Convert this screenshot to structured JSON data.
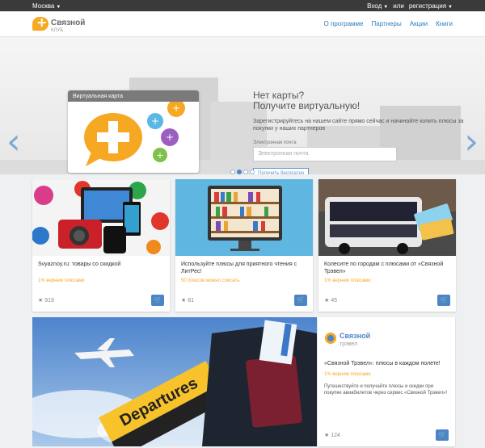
{
  "topbar": {
    "city": "Москва",
    "login": "Вход",
    "or": "или",
    "register": "регистрация"
  },
  "header": {
    "logo_big": "Связной",
    "logo_small": "КЛУБ",
    "nav": [
      "О программе",
      "Партнеры",
      "Акции",
      "Книги"
    ]
  },
  "hero": {
    "card_title": "Виртуальная карта",
    "heading_1": "Нет карты?",
    "heading_2": "Получите виртуальную!",
    "text": "Зарегистрируйтесь на нашем сайте прямо сейчас и начинайте копить плюсы за покупки у наших партнеров",
    "email_label": "Электронная почта",
    "email_placeholder": "Электронная почта",
    "button": "Получить бесплатно"
  },
  "cards": [
    {
      "title": "Svyaznoy.ru: товары со скидкой",
      "offer": "1% вернем плюсами",
      "stars": "919"
    },
    {
      "title": "Используйте плюсы для приятного чтения с ЛитРес!",
      "offer": "50 плюсов можно списать",
      "stars": "81"
    },
    {
      "title": "Колесите по городам с плюсами от «Связной Трэвел»",
      "offer": "1% вернем плюсами",
      "stars": "45"
    }
  ],
  "feature": {
    "banner_text": "Departures",
    "brand_big": "Связной",
    "brand_small": "трэвел",
    "title": "«Связной Трэвел»: плюсы в каждом полете!",
    "offer": "1% вернем плюсами",
    "desc": "Путешествуйте и получайте плюсы и скидки при покупке авиабилетов через сервис «Связной Трэвел»!",
    "stars": "124"
  },
  "icons": {
    "cart": "cart-icon",
    "star": "star-icon",
    "prev": "chevron-left-icon",
    "next": "chevron-right-icon"
  },
  "colors": {
    "accent": "#4a85c8",
    "orange": "#f7a823",
    "topbar": "#3a3a3a"
  }
}
